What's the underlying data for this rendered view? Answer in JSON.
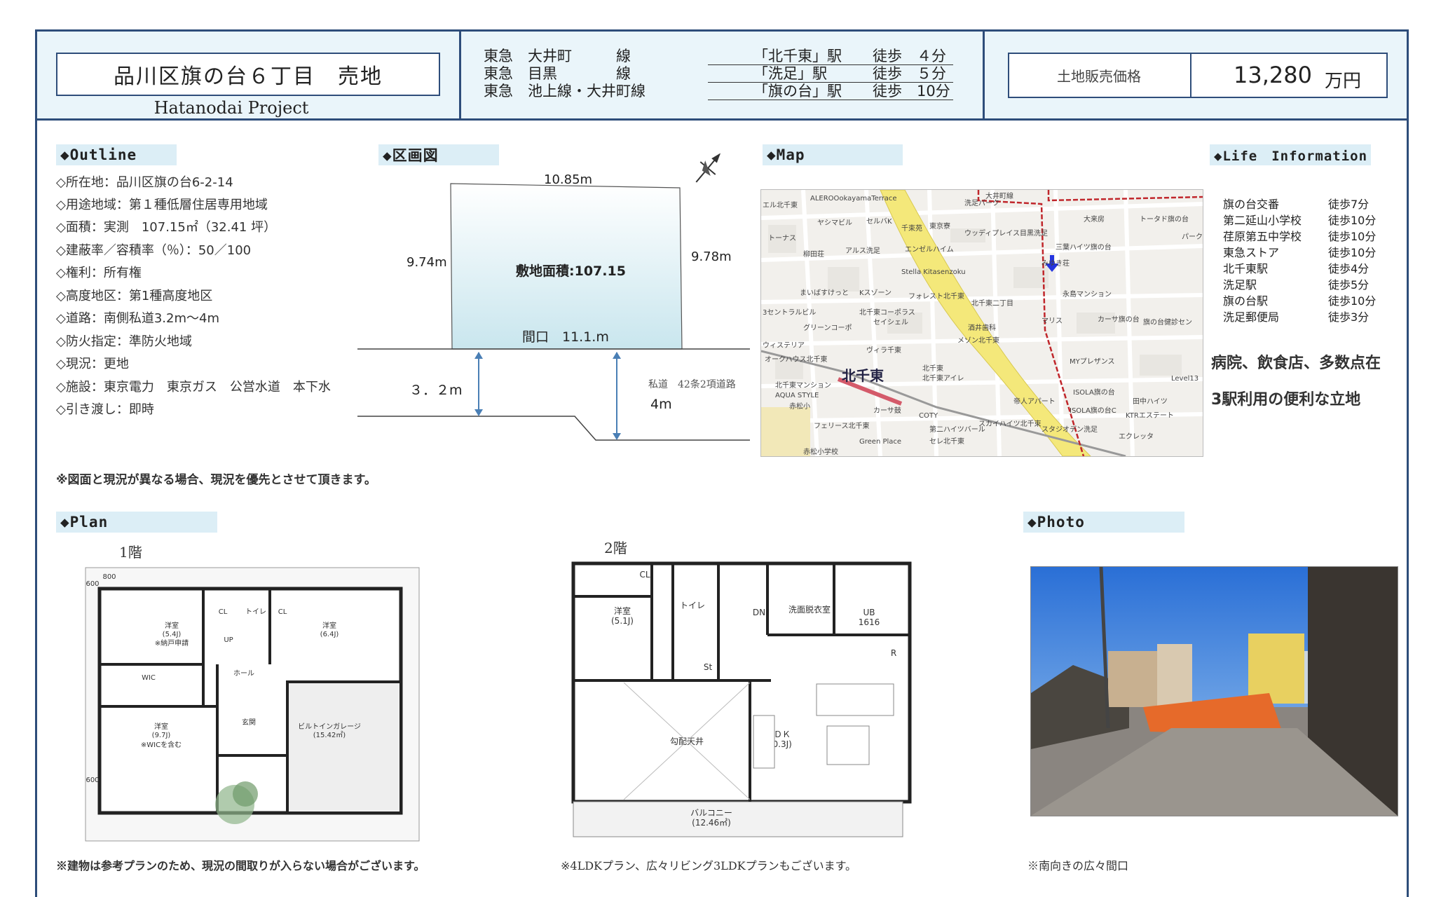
{
  "header": {
    "title": "品川区旗の台６丁目　売地",
    "subtitle": "Hatanodai Project",
    "stations": [
      {
        "line": "東急　大井町　　　線",
        "station": "「北千東」駅",
        "walk": "徒歩　４分"
      },
      {
        "line": "東急　目黒　　　　線",
        "station": "「洗足」駅",
        "walk": "徒歩　５分"
      },
      {
        "line": "東急　池上線・大井町線",
        "station": "「旗の台」駅",
        "walk": "徒歩　10分"
      }
    ],
    "price_label": "土地販売価格",
    "price_value": "13,280",
    "price_unit": "万円"
  },
  "outline": {
    "heading": "◆Outline",
    "items": [
      "◇所在地：品川区旗の台6-2-14",
      "◇用途地域：第１種低層住居専用地域",
      "◇面積：実測　107.15㎡（32.41 坪）",
      "◇建蔽率／容積率（％）：50／100",
      "◇権利：所有権",
      "◇高度地区：第1種高度地区",
      "◇道路：南側私道3.2m〜4m",
      "◇防火指定：準防火地域",
      "◇現況：更地",
      "◇施設：東京電力　東京ガス　公営水道　本下水",
      "◇引き渡し：即時"
    ],
    "note": "※図面と現況が異なる場合、現況を優先とさせて頂きます。"
  },
  "plot": {
    "heading": "◆区画図",
    "top": "10.85m",
    "left": "9.74m",
    "right": "9.78m",
    "area": "敷地面積:107.15",
    "frontage": "間口　11.1.m",
    "road_left": "３．２m",
    "road_right": "4m",
    "road_note": "私道　42条2項道路"
  },
  "map": {
    "heading": "◆Map",
    "labels": [
      "ALEROOokayamaTerrace",
      "エル北千東",
      "ヤシマビル",
      "セルバK",
      "千束苑",
      "東京寮",
      "洗足パーク",
      "大井町線",
      "大来房",
      "トータド旗の台",
      "トーナス",
      "柳田荘",
      "アルス洗足",
      "エンゼルハイム",
      "ウッディプレイス目黒洗足",
      "三葉ハイツ旗の台",
      "パーク",
      "Stella Kitasenzoku",
      "みゆき荘",
      "まいばすけっと",
      "Kスゾーン",
      "フォレスト北千東",
      "北千東二丁目",
      "永島マンション",
      "3セントラルビル",
      "北千東コーポラス",
      "セイシェル",
      "カーサ旗の台",
      "旗の台健診セン",
      "グリーンコーポ",
      "酒井歯科",
      "マリス",
      "メゾン北千東",
      "ウィステリア",
      "ヴィラ千東",
      "オークハウス北千東",
      "MYプレザンス",
      "北千東",
      "北千東マンション",
      "北千東アイレ",
      "Level13",
      "AQUA STYLE",
      "ISOLA旗の台",
      "田中ハイツ",
      "赤松小",
      "カーサ鼓",
      "COTY",
      "帝人アパート",
      "ISOLA旗の台C",
      "KTRエステート",
      "フェリース北千東",
      "第二ハイツバール",
      "スカイハイツ北千束",
      "スタジオデン洗足",
      "Green Place",
      "セレ北千東",
      "エクレッタ",
      "赤松小学校"
    ],
    "station_label": "北千東"
  },
  "life": {
    "heading": "◆Life　Information",
    "items": [
      {
        "name": "旗の台交番",
        "dist": "徒歩7分"
      },
      {
        "name": "第二延山小学校",
        "dist": "徒歩10分"
      },
      {
        "name": "荏原第五中学校",
        "dist": "徒歩10分"
      },
      {
        "name": "東急ストア",
        "dist": "徒歩10分"
      },
      {
        "name": "北千東駅",
        "dist": "徒歩4分"
      },
      {
        "name": "洗足駅",
        "dist": "徒歩5分"
      },
      {
        "name": "旗の台駅",
        "dist": "徒歩10分"
      },
      {
        "name": "洗足郵便局",
        "dist": "徒歩3分"
      }
    ],
    "line1": "病院、飲食店、多数点在",
    "line2": "3駅利用の便利な立地"
  },
  "plan": {
    "heading": "◆Plan",
    "floor1": "1階",
    "floor2": "2階",
    "f1_labels": {
      "room1": "洋室",
      "room1_size": "(5.4J)",
      "room1_note": "※納戸申請",
      "room2": "洋室",
      "room2_size": "(6.4J)",
      "room3": "洋室",
      "room3_size": "(9.7J)",
      "room3_note": "※WICを含む",
      "wic": "WIC",
      "hall": "ホール",
      "entry": "玄関",
      "toilet": "トイレ",
      "cl1": "CL",
      "cl2": "CL",
      "up": "UP",
      "garage": "ビルトインガレージ",
      "garage_size": "(15.42㎡)",
      "dim1": "600",
      "dim2": "800",
      "dim3": "600"
    },
    "f2_labels": {
      "room": "洋室",
      "room_size": "(5.1J)",
      "cl": "CL",
      "toilet": "トイレ",
      "dn": "DN",
      "st": "St",
      "wash": "洗面脱衣室",
      "ub": "UB",
      "ub_size": "1616",
      "r": "R",
      "ldk": "ＬＤＫ",
      "ldk_size": "(20.3J)",
      "ceiling": "勾配天井",
      "balcony": "バルコニー",
      "balcony_size": "(12.46㎡)"
    },
    "note1": "※建物は参考プランのため、現況の間取りが入らない場合がございます。",
    "note2": "※4LDKプラン、広々リビング3LDKプランもございます。"
  },
  "photo": {
    "heading": "◆Photo",
    "note": "※南向きの広々間口"
  },
  "colors": {
    "frame": "#2e4d7a",
    "header_bg": "#eaf5fa",
    "section_bg": "#dceef6",
    "road": "#f4e87a",
    "rail": "#c0262b"
  }
}
